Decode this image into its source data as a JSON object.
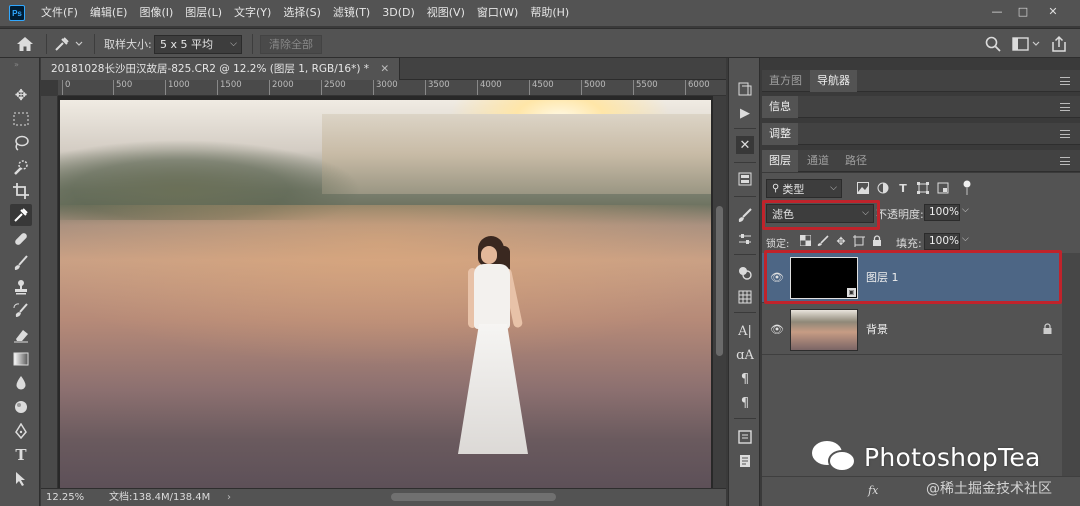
{
  "menubar": {
    "logo": "Ps",
    "items": [
      "文件(F)",
      "编辑(E)",
      "图像(I)",
      "图层(L)",
      "文字(Y)",
      "选择(S)",
      "滤镜(T)",
      "3D(D)",
      "视图(V)",
      "窗口(W)",
      "帮助(H)"
    ],
    "controls": {
      "minimize": "—",
      "maximize": "□",
      "close": "✕"
    }
  },
  "options": {
    "sample_size_label": "取样大小:",
    "sample_size_value": "5 x 5 平均",
    "clear_all": "清除全部"
  },
  "document": {
    "tab_title": "20181028长沙田汉故居-825.CR2 @ 12.2% (图层 1, RGB/16*) *",
    "ruler_ticks": [
      "0",
      "500",
      "1000",
      "1500",
      "2000",
      "2500",
      "3000",
      "3500",
      "4000",
      "4500",
      "5000",
      "5500",
      "6000"
    ],
    "zoom": "12.25%",
    "doc_size": "文档:138.4M/138.4M"
  },
  "panels": {
    "group1": {
      "tabs": [
        "直方图",
        "导航器"
      ],
      "active": 1
    },
    "group2": {
      "tabs": [
        "信息"
      ]
    },
    "group3": {
      "tabs": [
        "调整"
      ]
    },
    "layers": {
      "tabs": [
        "图层",
        "通道",
        "路径"
      ],
      "active": 0
    },
    "filter_kind": "类型",
    "blend_mode": "滤色",
    "opacity_label": "不透明度:",
    "opacity_value": "100%",
    "lock_label": "锁定:",
    "fill_label": "填充:",
    "fill_value": "100%",
    "layer_list": [
      {
        "name": "图层 1",
        "selected": true,
        "visible": true,
        "locked": false
      },
      {
        "name": "背景",
        "selected": false,
        "visible": true,
        "locked": true
      }
    ]
  },
  "watermark": {
    "brand": "PhotoshopTea",
    "community": "@稀土掘金技术社区"
  },
  "colors": {
    "selection": "#4d6685",
    "highlight_box": "#c0232b",
    "ps_blue": "#31a8ff"
  }
}
